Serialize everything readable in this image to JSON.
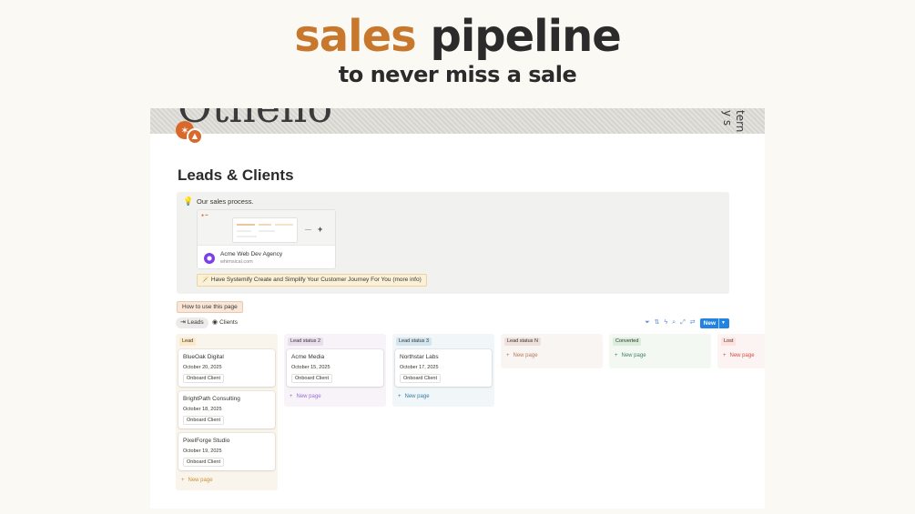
{
  "promo": {
    "title_accent": "sales",
    "title_rest": "pipeline",
    "subtitle": "to never miss a sale"
  },
  "cover": {
    "text_left": "Othello",
    "text_right": "tern y s"
  },
  "page": {
    "title": "Leads & Clients"
  },
  "callout": {
    "icon": "💡",
    "text": "Our sales process.",
    "bookmark": {
      "title": "Acme Web Dev Agency",
      "url": "whimsical.com"
    },
    "systemify_label": "🪄 Have Systemify Create and Simplify Your Customer Journey For You (more info)"
  },
  "how_to_use_label": "How to use this page",
  "tabs": [
    {
      "label": "Leads",
      "icon": "⇥"
    },
    {
      "label": "Clients",
      "icon": "◉"
    }
  ],
  "toolbar": {
    "new_label": "New",
    "icons": [
      "filter-icon",
      "sort-icon",
      "lightning-icon",
      "search-icon",
      "expand-icon",
      "settings-icon"
    ]
  },
  "board": {
    "new_page_label": "New page",
    "columns": [
      {
        "name": "Lead",
        "tag_color": "#fbe9c8",
        "bg_color": "#faf5ec",
        "accent": "#cb912f",
        "cards": [
          {
            "title": "BlueOak Digital",
            "date": "October 20, 2025",
            "action": "Onboard Client"
          },
          {
            "title": "BrightPath Consulting",
            "date": "October 18, 2025",
            "action": "Onboard Client"
          },
          {
            "title": "PixelForge Studio",
            "date": "October 19, 2025",
            "action": "Onboard Client"
          }
        ]
      },
      {
        "name": "Lead status 2",
        "tag_color": "#e8deee",
        "bg_color": "#f7f3f8",
        "accent": "#9a6dd7",
        "cards": [
          {
            "title": "Acme Media",
            "date": "October 15, 2025",
            "action": "Onboard Client"
          }
        ]
      },
      {
        "name": "Lead status 3",
        "tag_color": "#d3e5ef",
        "bg_color": "#f1f6f9",
        "accent": "#337ea9",
        "cards": [
          {
            "title": "Northstar Labs",
            "date": "October 17, 2025",
            "action": "Onboard Client"
          }
        ]
      },
      {
        "name": "Lead status N",
        "tag_color": "#eee0da",
        "bg_color": "#f9f5f3",
        "accent": "#b87a5b",
        "cards": []
      },
      {
        "name": "Converted",
        "tag_color": "#dbeddb",
        "bg_color": "#f3f8f3",
        "accent": "#448361",
        "cards": []
      },
      {
        "name": "Lost",
        "tag_color": "#ffe2dd",
        "bg_color": "#fcf4f3",
        "accent": "#d44c47",
        "cards": []
      }
    ]
  }
}
